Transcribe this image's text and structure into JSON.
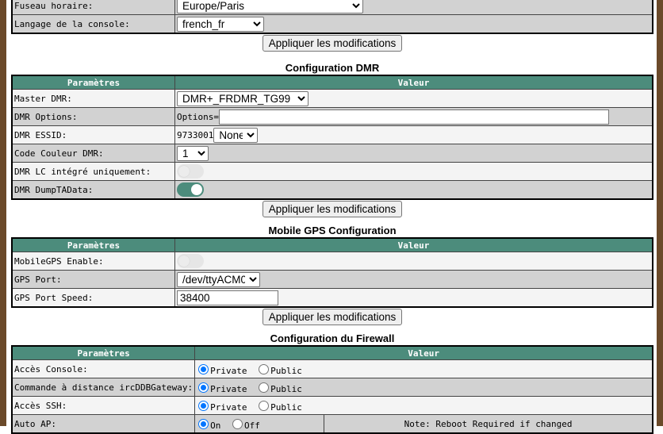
{
  "general": {
    "rows": [
      {
        "label": "Fuseau horaire:",
        "value": "Europe/Paris"
      },
      {
        "label": "Langage de la console:",
        "value": "french_fr"
      }
    ],
    "apply_label": "Appliquer les modifications"
  },
  "dmr": {
    "title": "Configuration DMR",
    "header": {
      "param": "Paramètres",
      "value": "Valeur"
    },
    "master_label": "Master DMR:",
    "master_value": "DMR+_FRDMR_TG99",
    "options_label": "DMR Options:",
    "options_prefix": "Options=",
    "options_value": "",
    "essid_label": "DMR ESSID:",
    "essid_prefix": "9733001",
    "essid_value": "None",
    "color_label": "Code Couleur DMR:",
    "color_value": "1",
    "lc_label": "DMR LC intégré uniquement:",
    "lc_on": false,
    "dump_label": "DMR DumpTAData:",
    "dump_on": true,
    "apply_label": "Appliquer les modifications"
  },
  "gps": {
    "title": "Mobile GPS Configuration",
    "header": {
      "param": "Paramètres",
      "value": "Valeur"
    },
    "enable_label": "MobileGPS Enable:",
    "enable_on": false,
    "port_label": "GPS Port:",
    "port_value": "/dev/ttyACM0",
    "speed_label": "GPS Port Speed:",
    "speed_value": "38400",
    "apply_label": "Appliquer les modifications"
  },
  "firewall": {
    "title": "Configuration du Firewall",
    "header": {
      "param": "Paramètres",
      "value": "Valeur"
    },
    "console_label": "Accès Console:",
    "remote_label": "Commande à distance ircDDBGateway:",
    "ssh_label": "Accès SSH:",
    "autoap_label": "Auto AP:",
    "private": "Private",
    "public": "Public",
    "on": "On",
    "off": "Off",
    "note": "Note: Reboot Required if changed"
  },
  "colors": {
    "header_bg": "#4c8c7c",
    "row_light": "#f4f4f4",
    "row_dark": "#d2d2d2",
    "radio_checked": "#0075ff"
  }
}
